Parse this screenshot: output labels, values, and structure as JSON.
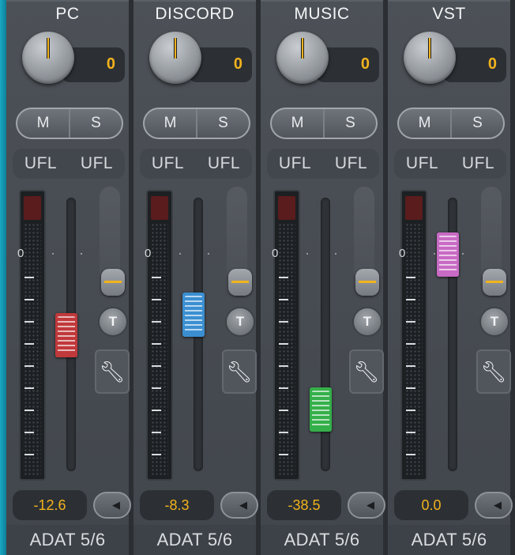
{
  "channels": [
    {
      "name": "PC",
      "pan": "0",
      "mute": "M",
      "solo": "S",
      "input_left": "UFL",
      "input_right": "UFL",
      "meter_zero": "0",
      "volume": "-12.6",
      "output": "ADAT 5/6",
      "fader_color": "#c0393b",
      "fader_level_db": -12.6
    },
    {
      "name": "DISCORD",
      "pan": "0",
      "mute": "M",
      "solo": "S",
      "input_left": "UFL",
      "input_right": "UFL",
      "meter_zero": "0",
      "volume": "-8.3",
      "output": "ADAT 5/6",
      "fader_color": "#3b8fd1",
      "fader_level_db": -8.3
    },
    {
      "name": "MUSIC",
      "pan": "0",
      "mute": "M",
      "solo": "S",
      "input_left": "UFL",
      "input_right": "UFL",
      "meter_zero": "0",
      "volume": "-38.5",
      "output": "ADAT 5/6",
      "fader_color": "#34b04a",
      "fader_level_db": -38.5
    },
    {
      "name": "VST",
      "pan": "0",
      "mute": "M",
      "solo": "S",
      "input_left": "UFL",
      "input_right": "UFL",
      "meter_zero": "0",
      "volume": "0.0",
      "output": "ADAT 5/6",
      "fader_color": "#c86bc4",
      "fader_level_db": 0.0
    }
  ],
  "buttons": {
    "trim": "T"
  },
  "icons": {
    "tool": "wrench-icon",
    "context": "chevron-left-icon"
  },
  "colors": {
    "accent": "#f2b21d",
    "background": "#2b2f33",
    "strip": "#4a4f55",
    "edge": "#1aa8c4"
  }
}
